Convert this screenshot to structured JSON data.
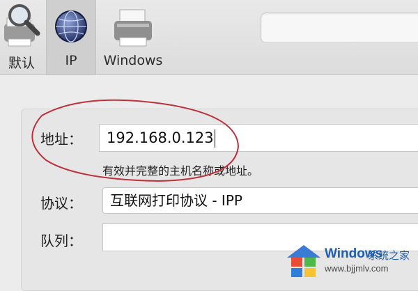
{
  "toolbar": {
    "items": [
      {
        "label": "默认",
        "icon": "magnifier-printer-icon",
        "selected": false
      },
      {
        "label": "IP",
        "icon": "globe-icon",
        "selected": true
      },
      {
        "label": "Windows",
        "icon": "printer-icon",
        "selected": false
      }
    ]
  },
  "form": {
    "address_label": "地址：",
    "address_value": "192.168.0.123",
    "address_hint": "有效并完整的主机名称或地址。",
    "protocol_label": "协议：",
    "protocol_value": "互联网打印协议 - IPP",
    "queue_label": "队列：",
    "queue_value": ""
  },
  "watermark": {
    "brand": "Windows",
    "site": "系统之家",
    "url": "www.bjjmlv.com"
  },
  "colors": {
    "annotation": "#c0303a",
    "watermark_blue": "#1e5db0"
  }
}
